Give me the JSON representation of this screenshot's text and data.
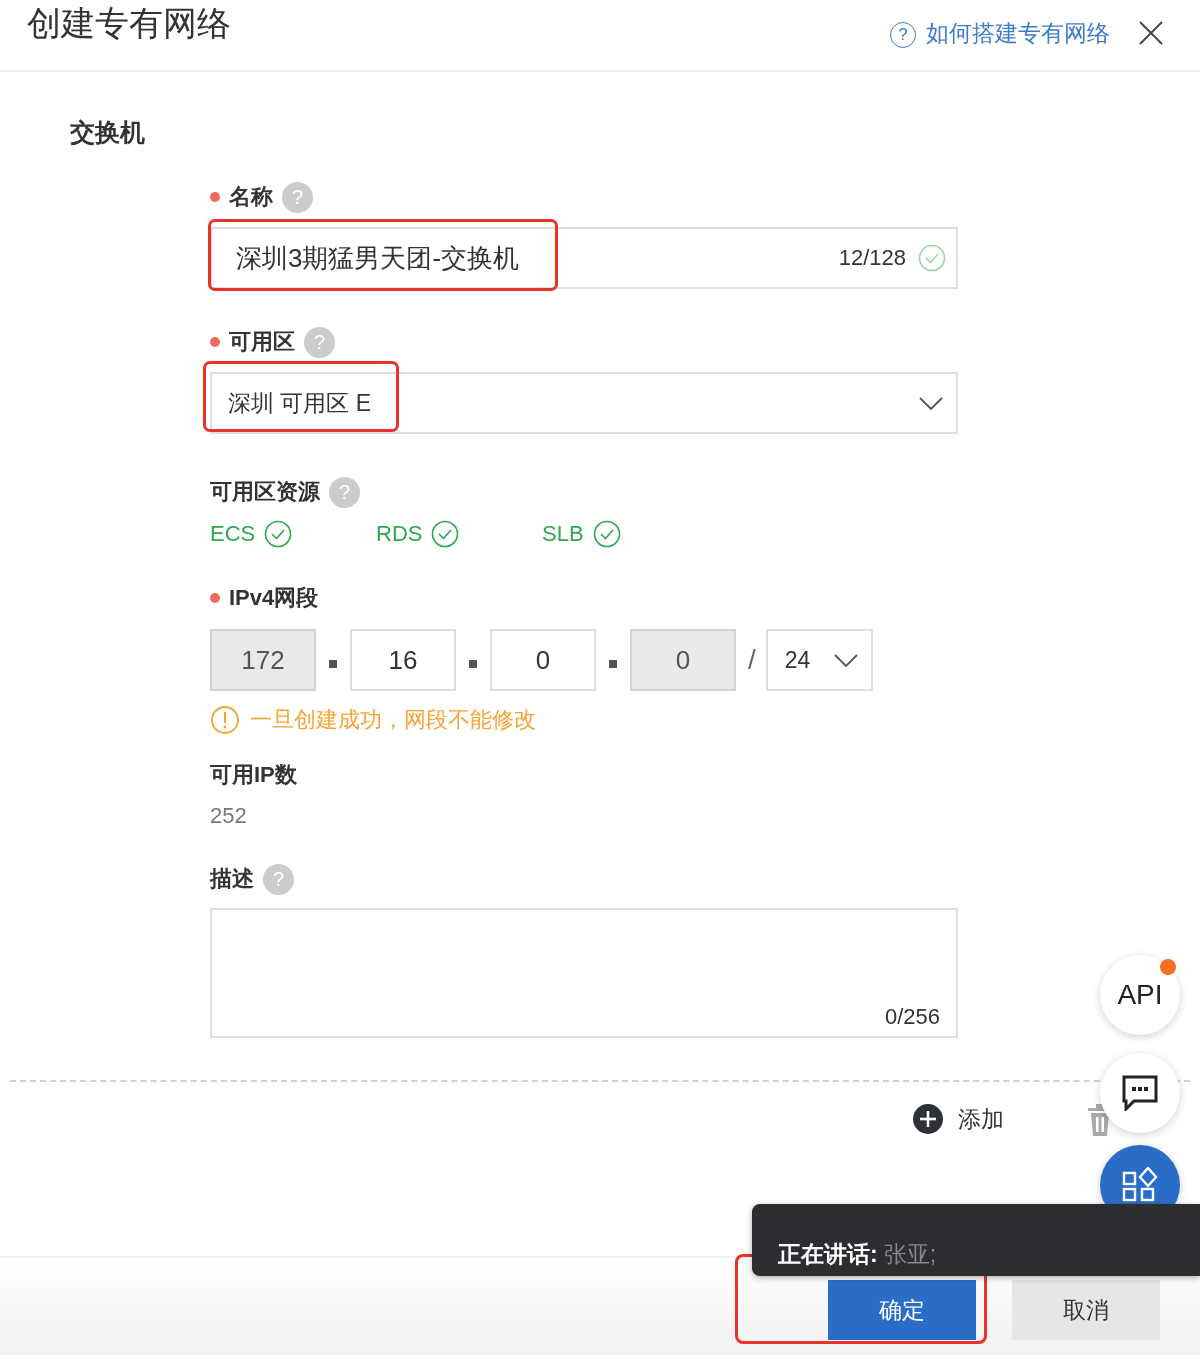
{
  "header": {
    "title": "创建专有网络",
    "help_icon": "?",
    "help_link": "如何搭建专有网络"
  },
  "section": {
    "title": "交换机"
  },
  "fields": [
    {
      "kind": "text",
      "label": "名称",
      "required": true,
      "help": "?",
      "value": "深圳3期猛男天团-交换机",
      "counter": "12/128",
      "valid": true,
      "highlighted": true
    },
    {
      "kind": "select",
      "label": "可用区",
      "required": true,
      "help": "?",
      "value": "深圳 可用区 E",
      "highlighted": true
    },
    {
      "kind": "resources",
      "label": "可用区资源",
      "required": false,
      "help": "?",
      "items": [
        {
          "name": "ECS",
          "available": true
        },
        {
          "name": "RDS",
          "available": true
        },
        {
          "name": "SLB",
          "available": true
        }
      ]
    },
    {
      "kind": "cidr",
      "label": "IPv4网段",
      "required": true,
      "octets": [
        {
          "value": "172",
          "disabled": true
        },
        {
          "value": "16",
          "disabled": false
        },
        {
          "value": "0",
          "disabled": false
        },
        {
          "value": "0",
          "disabled": true
        }
      ],
      "slash": "/",
      "mask": "24",
      "warning": "一旦创建成功，网段不能修改"
    },
    {
      "kind": "readout",
      "label": "可用IP数",
      "required": false,
      "value": "252"
    },
    {
      "kind": "textarea",
      "label": "描述",
      "required": false,
      "help": "?",
      "counter": "0/256"
    }
  ],
  "row_actions": {
    "add": "添加"
  },
  "float_buttons": [
    {
      "kind": "api",
      "label": "API",
      "notification": true
    },
    {
      "kind": "chat"
    },
    {
      "kind": "apps"
    }
  ],
  "talk_bar": {
    "label": "正在讲话:",
    "speaker": "张亚;"
  },
  "footer": {
    "buttons": [
      {
        "label": "确定",
        "primary": true,
        "highlighted": true
      },
      {
        "label": "取消",
        "primary": false,
        "highlighted": false
      }
    ]
  }
}
